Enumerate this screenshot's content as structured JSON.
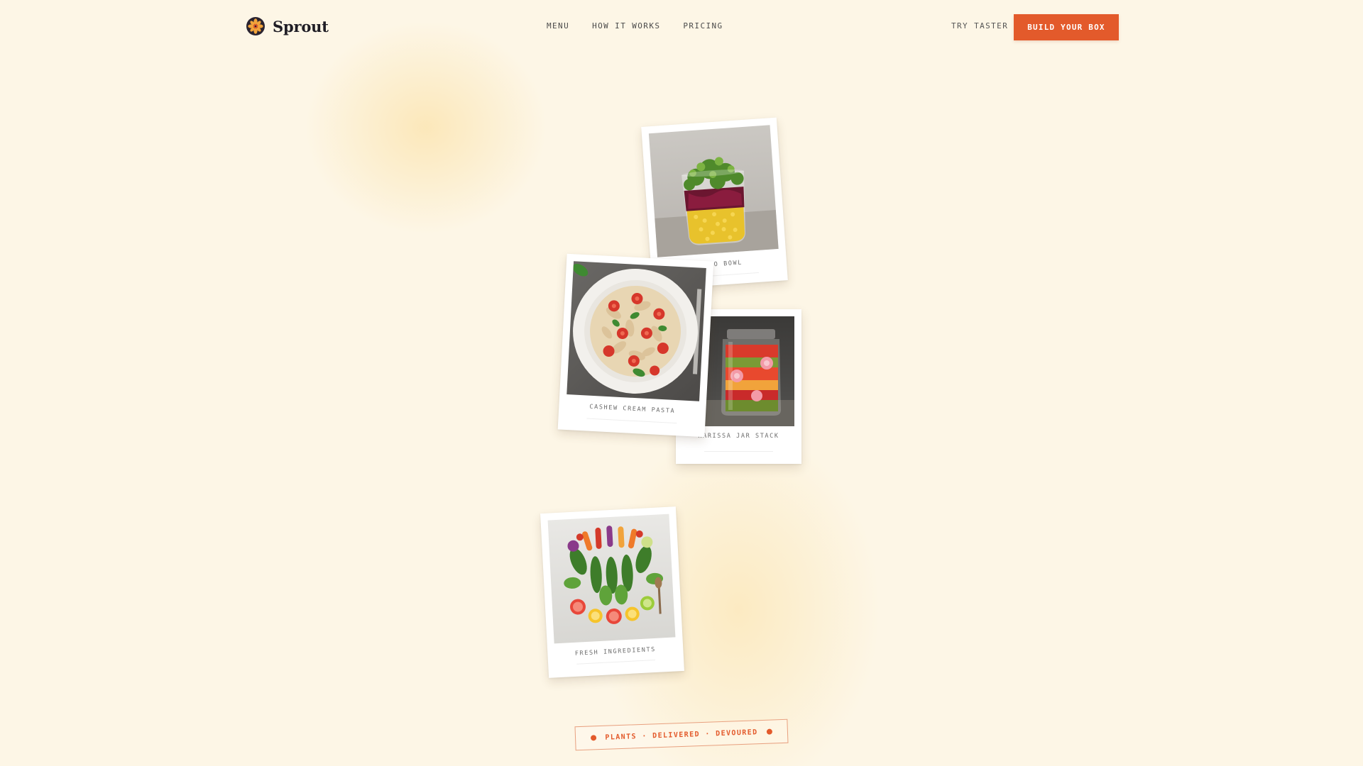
{
  "brand": {
    "name": "Sprout",
    "logo_icon": "sprout-flower-logo-icon",
    "accent_color": "#e35a2b"
  },
  "nav": {
    "items": [
      {
        "label": "MENU"
      },
      {
        "label": "HOW IT WORKS"
      },
      {
        "label": "PRICING"
      }
    ],
    "try_label": "TRY TASTER",
    "cta_label": "BUILD YOUR BOX"
  },
  "polaroids": [
    {
      "caption": "FARRO BOWL",
      "image": "farro-bowl-jar-photo"
    },
    {
      "caption": "CASHEW CREAM PASTA",
      "image": "pasta-bowl-photo"
    },
    {
      "caption": "HARISSA JAR STACK",
      "image": "harissa-jar-photo"
    },
    {
      "caption": "FRESH INGREDIENTS",
      "image": "fresh-ingredients-photo"
    }
  ],
  "stamp": {
    "text": "PLANTS · DELIVERED · DEVOURED"
  }
}
